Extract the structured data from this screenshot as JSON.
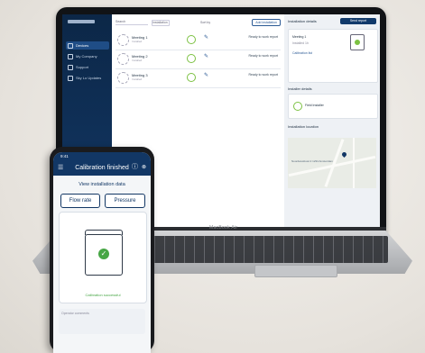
{
  "laptop": {
    "brand": "MacBook Air",
    "sidebar": {
      "items": [
        {
          "label": "Devices",
          "active": true
        },
        {
          "label": "My Company",
          "active": false
        },
        {
          "label": "Support",
          "active": false
        },
        {
          "label": "Sky Lo Updates",
          "active": false
        }
      ]
    },
    "toolbar": {
      "search_placeholder": "Search",
      "filter_label": "Installation",
      "sort_label": "Sort by",
      "add_button": "Add installation"
    },
    "rows": [
      {
        "name": "Meeting 1",
        "sub": "Installed",
        "status": "Ready to work report"
      },
      {
        "name": "Meeting 2",
        "sub": "Installed",
        "status": "Ready to work report"
      },
      {
        "name": "Meeting 3",
        "sub": "Installed",
        "status": "Ready to work report"
      }
    ],
    "detail": {
      "heading": "Installation details",
      "button": "Send report",
      "card_title": "Meeting 1",
      "card_sub": "Installed 1h",
      "card_link": "Calibration list",
      "section2": "Installer details",
      "installer": "Field Installer",
      "section3": "Installation location",
      "map_label": "Noordwestkust 2\n1234 Amsterdam"
    }
  },
  "phone": {
    "time": "9:41",
    "title": "Calibration finished",
    "view_label": "View installation data",
    "buttons": [
      "Flow rate",
      "Pressure"
    ],
    "calibration_text": "Calibration successful",
    "input_placeholder": "Operator comments",
    "accent": "#123765",
    "success": "#47a645"
  }
}
